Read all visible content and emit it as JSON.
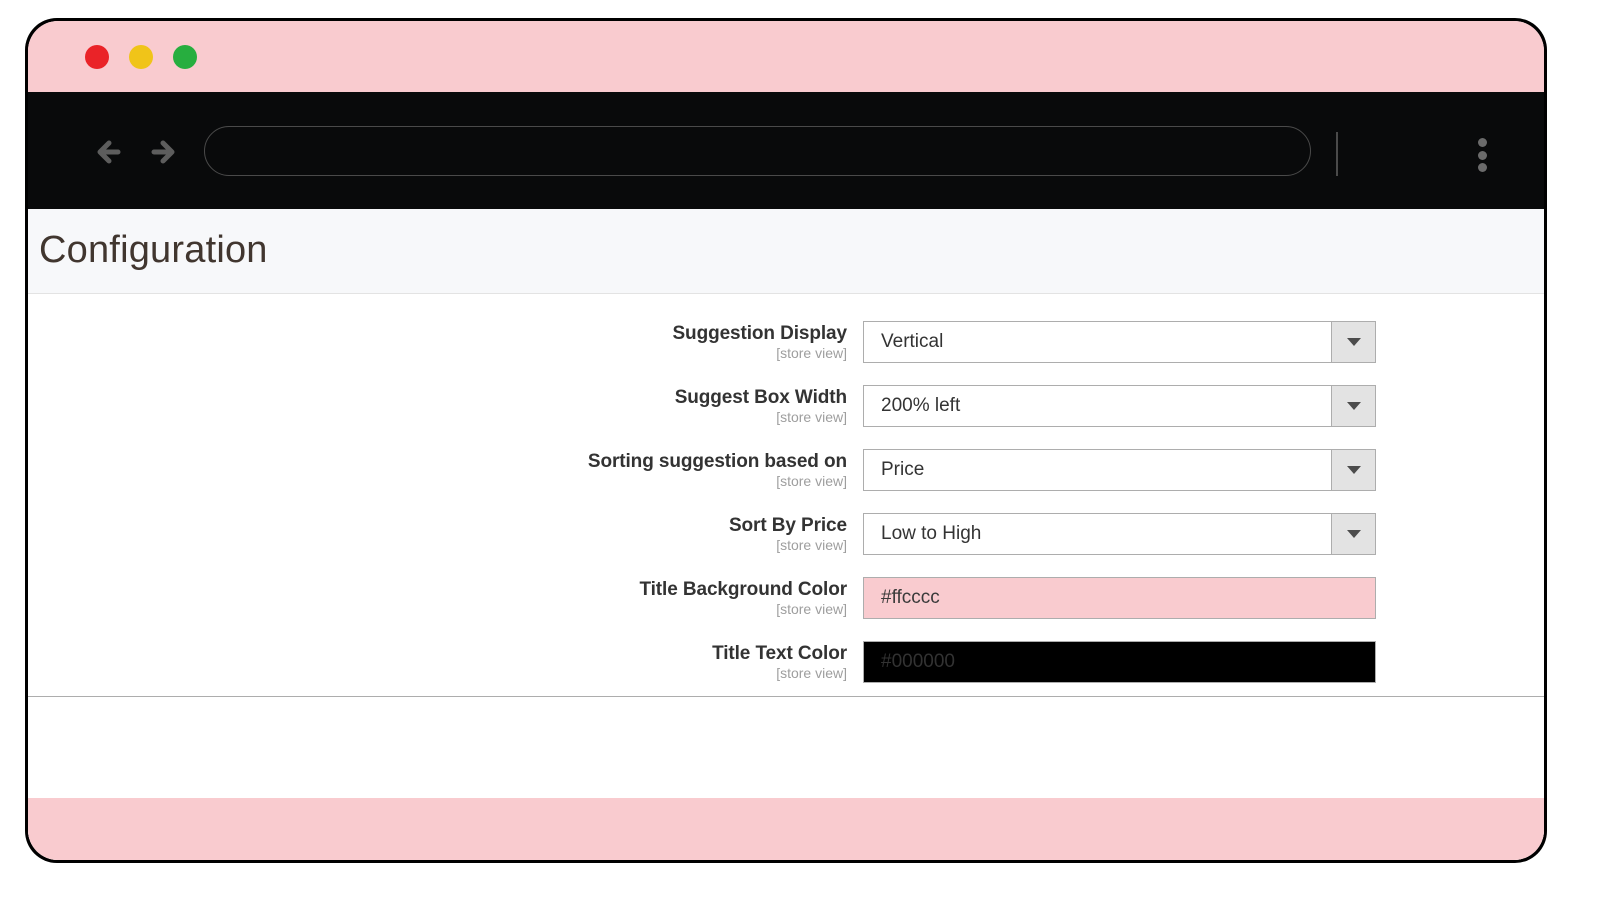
{
  "browser": {
    "traffic_lights": [
      {
        "name": "close",
        "color": "#ea2328"
      },
      {
        "name": "minimize",
        "color": "#f0c419"
      },
      {
        "name": "maximize",
        "color": "#27ae3f"
      }
    ],
    "back_icon": "back-arrow-icon",
    "forward_icon": "forward-arrow-icon",
    "url_value": "",
    "url_placeholder": "",
    "menu_icon": "kebab-menu-icon"
  },
  "page": {
    "title": "Configuration"
  },
  "form": {
    "scope_label": "[store view]",
    "fields": [
      {
        "label": "Suggestion Display",
        "scope": "[store view]",
        "type": "select",
        "value": "Vertical"
      },
      {
        "label": "Suggest Box Width",
        "scope": "[store view]",
        "type": "select",
        "value": "200% left"
      },
      {
        "label": "Sorting suggestion based on",
        "scope": "[store view]",
        "type": "select",
        "value": "Price"
      },
      {
        "label": "Sort By Price",
        "scope": "[store view]",
        "type": "select",
        "value": "Low to High"
      },
      {
        "label": "Title Background Color",
        "scope": "[store view]",
        "type": "color",
        "value": "#ffcccc",
        "swatch": "#ffcccc"
      },
      {
        "label": "Title Text Color",
        "scope": "[store view]",
        "type": "color",
        "value": "#000000",
        "swatch": "#000000"
      }
    ]
  },
  "theme": {
    "titlebar_color": "#f9cbcf",
    "toolbar_color": "#090a0b",
    "header_bg": "#f7f8fa",
    "title_text_color": "#41362f",
    "footer_color": "#f9cbcf"
  }
}
